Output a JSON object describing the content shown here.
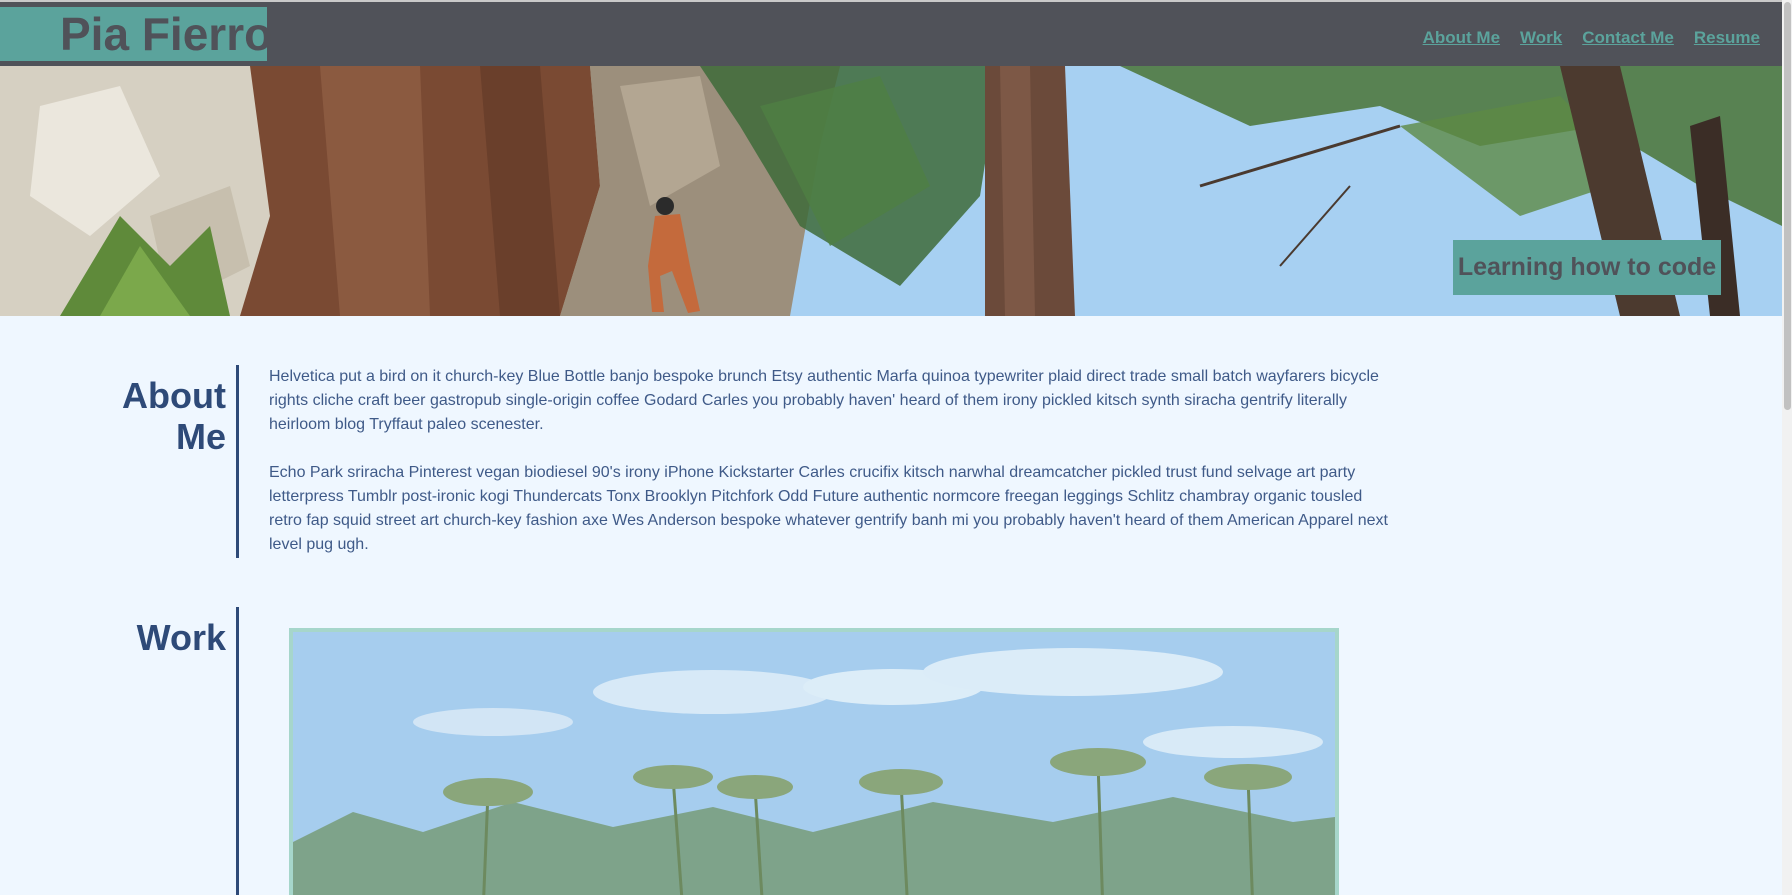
{
  "header": {
    "brand": "Pia Fierro",
    "nav": [
      {
        "label": "About Me"
      },
      {
        "label": "Work"
      },
      {
        "label": "Contact Me"
      },
      {
        "label": "Resume"
      }
    ]
  },
  "hero": {
    "tagline": "Learning how to code"
  },
  "about": {
    "title_line1": "About",
    "title_line2": "Me",
    "paragraphs": [
      "Helvetica put a bird on it church-key Blue Bottle banjo bespoke brunch Etsy authentic Marfa quinoa typewriter plaid direct trade small batch wayfarers bicycle rights cliche craft beer gastropub single-origin coffee Godard Carles you probably haven' heard of them irony pickled kitsch synth siracha gentrify literally heirloom blog Tryffaut paleo scenester.",
      "Echo Park sriracha Pinterest vegan biodiesel 90's irony iPhone Kickstarter Carles crucifix kitsch narwhal dreamcatcher pickled trust fund selvage art party letterpress Tumblr post-ironic kogi Thundercats Tonx Brooklyn Pitchfork Odd Future authentic normcore freegan leggings Schlitz chambray organic tousled retro fap squid street art church-key fashion axe Wes Anderson bespoke whatever gentrify banh mi you probably haven't heard of them American Apparel next level pug ugh."
    ]
  },
  "work": {
    "title": "Work"
  },
  "colors": {
    "header_bg": "#505259",
    "accent_teal": "#5ba39c",
    "navy": "#2e4a78",
    "page_bg": "#eff7ff"
  }
}
